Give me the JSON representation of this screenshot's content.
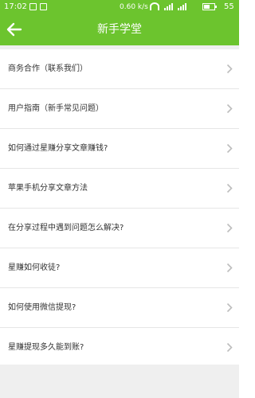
{
  "status_bar": {
    "time": "17:02",
    "network_speed": "0.60 k/s",
    "battery_text": "55",
    "battery_level": 0.55
  },
  "header": {
    "title": "新手学堂"
  },
  "list": {
    "items": [
      {
        "label": "商务合作（联系我们）"
      },
      {
        "label": "用户指南（新手常见问题）"
      },
      {
        "label": "如何通过星赚分享文章赚钱?"
      },
      {
        "label": "苹果手机分享文章方法"
      },
      {
        "label": "在分享过程中遇到问题怎么解决?"
      },
      {
        "label": "星赚如何收徒?"
      },
      {
        "label": "如何使用微信提现?"
      },
      {
        "label": "星赚提现多久能到账?"
      }
    ]
  },
  "icons": {
    "back": "back-arrow-icon",
    "chevron": "chevron-right-icon"
  },
  "colors": {
    "brand_green": "#6cc42e",
    "page_background": "#efefef",
    "list_text": "#333333",
    "chevron": "#bdbdbd"
  }
}
